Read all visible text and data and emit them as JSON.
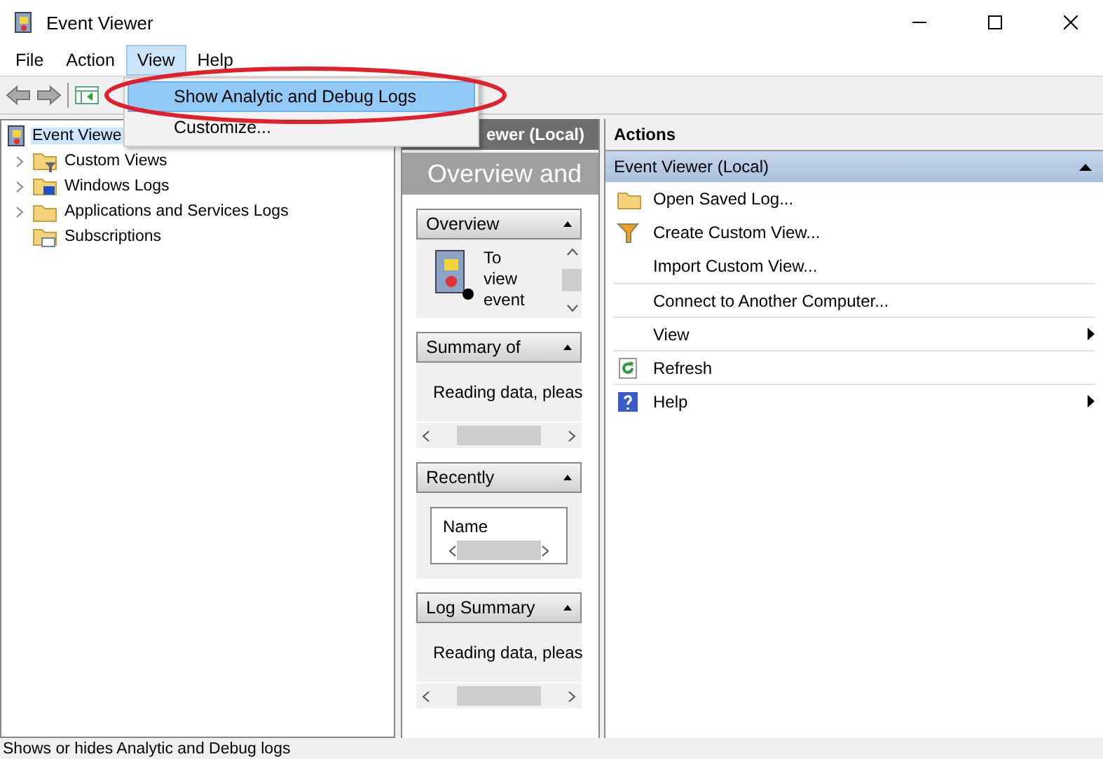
{
  "window": {
    "title": "Event Viewer"
  },
  "menu_bar": [
    {
      "label": "File",
      "selected": false
    },
    {
      "label": "Action",
      "selected": false
    },
    {
      "label": "View",
      "selected": true
    },
    {
      "label": "Help",
      "selected": false
    }
  ],
  "view_menu": [
    {
      "label": "Show Analytic and Debug Logs",
      "selected": true
    },
    {
      "label": "Customize...",
      "selected": false
    }
  ],
  "tree": {
    "label": "Event Viewe",
    "selected": true,
    "children": [
      {
        "label": "Custom Views",
        "expandable": true
      },
      {
        "label": "Windows Logs",
        "expandable": true
      },
      {
        "label": "Applications and Services Logs",
        "expandable": true
      },
      {
        "label": "Subscriptions",
        "expandable": false
      }
    ]
  },
  "overview": {
    "header": "ewer (Local)",
    "title": "Overview and",
    "sections": [
      {
        "kind": "intro",
        "title": "Overview",
        "lines": [
          "To",
          "view",
          "event"
        ]
      },
      {
        "kind": "reading",
        "title": "Summary of",
        "text": "Reading data, pleas"
      },
      {
        "kind": "list",
        "title": "Recently",
        "column": "Name"
      },
      {
        "kind": "reading",
        "title": "Log Summary",
        "text": "Reading data, pleas"
      }
    ]
  },
  "actions": {
    "title": "Actions",
    "group": "Event Viewer (Local)",
    "items": [
      {
        "label": "Open Saved Log...",
        "group_start": false,
        "submenu": false
      },
      {
        "label": "Create Custom View...",
        "group_start": false,
        "submenu": false
      },
      {
        "label": "Import Custom View...",
        "group_start": false,
        "submenu": false
      },
      {
        "label": "Connect to Another Computer...",
        "group_start": true,
        "submenu": false
      },
      {
        "label": "View",
        "group_start": true,
        "submenu": true
      },
      {
        "label": "Refresh",
        "group_start": true,
        "submenu": false
      },
      {
        "label": "Help",
        "group_start": true,
        "submenu": true
      }
    ]
  },
  "status_bar": "Shows or hides Analytic and Debug logs"
}
